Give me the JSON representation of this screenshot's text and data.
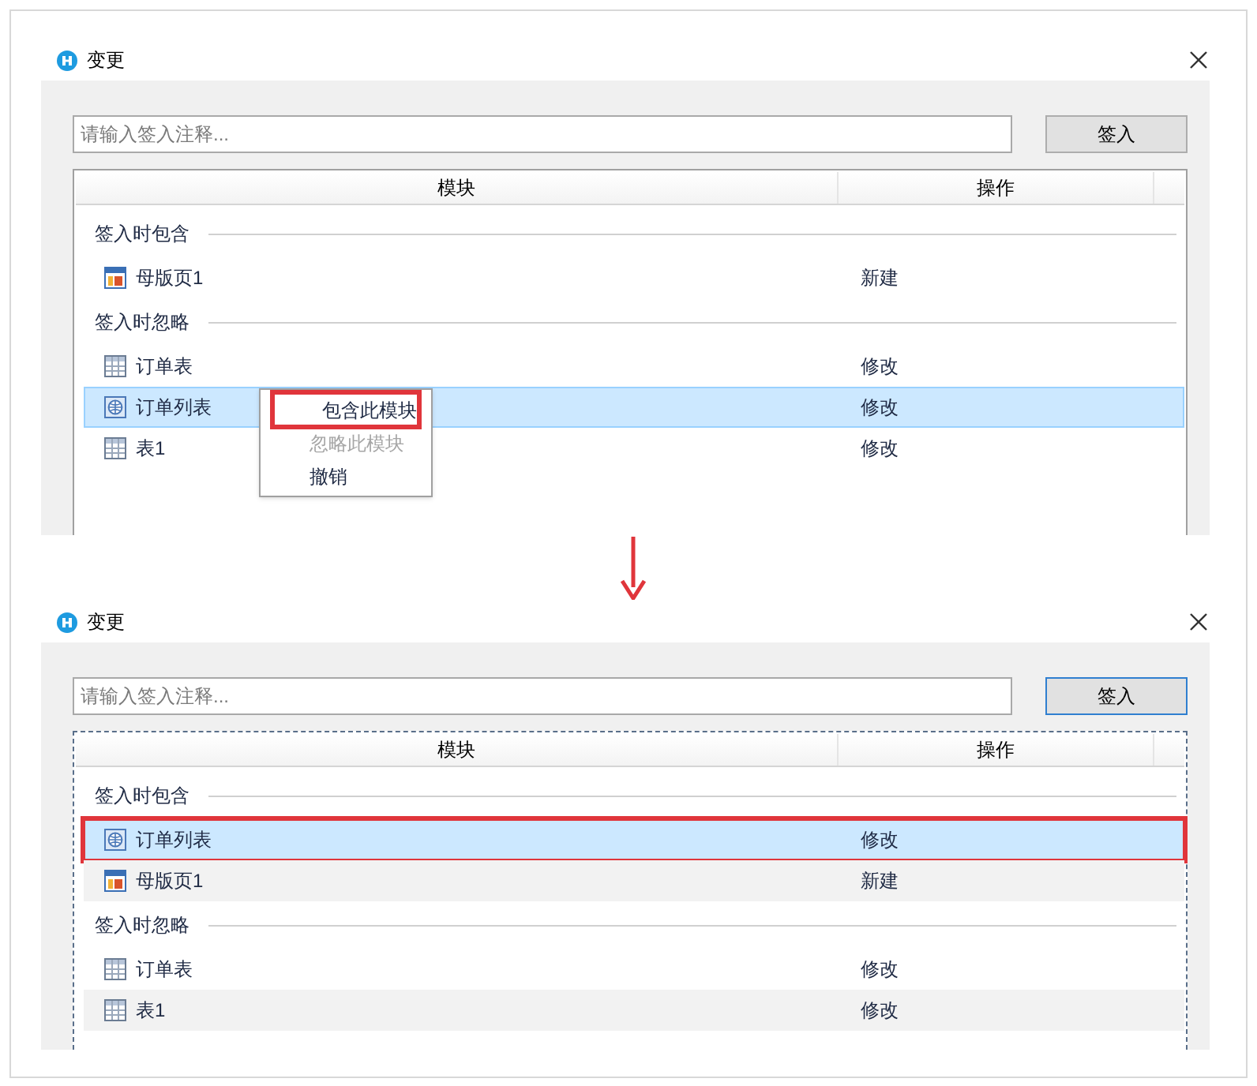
{
  "dialogs": [
    {
      "title": "变更",
      "placeholder": "请输入签入注释...",
      "button": {
        "label": "签入",
        "focused": false
      },
      "table": {
        "focused": false,
        "columns": [
          "模块",
          "操作"
        ],
        "groups": [
          {
            "label": "签入时包含",
            "rows": [
              {
                "kind": "master",
                "name": "母版页1",
                "action": "新建",
                "selected": false,
                "highlighted": false,
                "striped": false
              }
            ]
          },
          {
            "label": "签入时忽略",
            "rows": [
              {
                "kind": "table",
                "name": "订单表",
                "action": "修改",
                "selected": false,
                "highlighted": false,
                "striped": false
              },
              {
                "kind": "list",
                "name": "订单列表",
                "action": "修改",
                "selected": true,
                "highlighted": false
              },
              {
                "kind": "table",
                "name": "表1",
                "action": "修改",
                "selected": false,
                "highlighted": false,
                "striped": false
              }
            ]
          }
        ]
      },
      "context_menu": [
        {
          "label": "包含此模块",
          "disabled": false,
          "highlighted": true
        },
        {
          "label": "忽略此模块",
          "disabled": true,
          "highlighted": false
        },
        {
          "label": "撤销",
          "disabled": false,
          "highlighted": false
        }
      ]
    },
    {
      "title": "变更",
      "placeholder": "请输入签入注释...",
      "button": {
        "label": "签入",
        "focused": true
      },
      "table": {
        "focused": true,
        "columns": [
          "模块",
          "操作"
        ],
        "groups": [
          {
            "label": "签入时包含",
            "rows": [
              {
                "kind": "list",
                "name": "订单列表",
                "action": "修改",
                "selected": true,
                "highlighted": true
              },
              {
                "kind": "master",
                "name": "母版页1",
                "action": "新建",
                "selected": false,
                "highlighted": false,
                "striped": true
              }
            ]
          },
          {
            "label": "签入时忽略",
            "rows": [
              {
                "kind": "table",
                "name": "订单表",
                "action": "修改",
                "selected": false,
                "highlighted": false,
                "striped": false
              },
              {
                "kind": "table",
                "name": "表1",
                "action": "修改",
                "selected": false,
                "highlighted": false,
                "striped": true
              }
            ]
          }
        ]
      }
    }
  ]
}
